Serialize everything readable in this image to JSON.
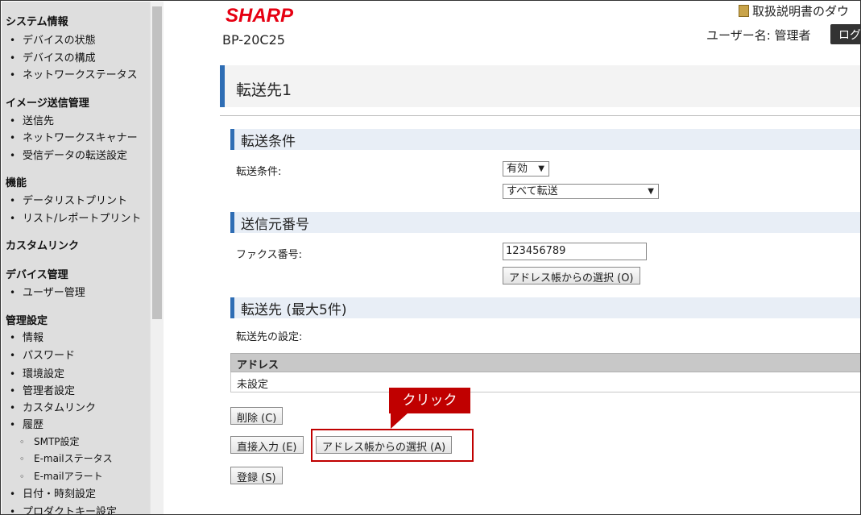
{
  "sidebar": {
    "sections": [
      {
        "title": "システム情報",
        "items": [
          "デバイスの状態",
          "デバイスの構成",
          "ネットワークステータス"
        ]
      },
      {
        "title": "イメージ送信管理",
        "items": [
          "送信先",
          "ネットワークスキャナー",
          "受信データの転送設定"
        ]
      },
      {
        "title": "機能",
        "items": [
          "データリストプリント",
          "リスト/レポートプリント"
        ]
      },
      {
        "title": "カスタムリンク",
        "items": []
      },
      {
        "title": "デバイス管理",
        "items": [
          "ユーザー管理"
        ]
      },
      {
        "title": "管理設定",
        "items": [
          "情報",
          "パスワード",
          "環境設定",
          "管理者設定",
          "カスタムリンク",
          "履歴"
        ]
      }
    ],
    "history_subitems": [
      "SMTP設定",
      "E-mailステータス",
      "E-mailアラート"
    ],
    "trailing_items": [
      "日付・時刻設定",
      "プロダクトキー設定"
    ]
  },
  "header": {
    "logo": "SHARP",
    "model": "BP-20C25",
    "manual_link": "取扱説明書のダウ",
    "username": "ユーザー名: 管理者",
    "logout_label": "ログ"
  },
  "page": {
    "title": "転送先1",
    "transfer_condition": {
      "heading": "転送条件",
      "label": "転送条件:",
      "enabled_select": "有効",
      "mode_select": "すべて転送"
    },
    "sender_number": {
      "heading": "送信元番号",
      "fax_label": "ファクス番号:",
      "fax_value": "123456789",
      "address_book_button": "アドレス帳からの選択 (O)"
    },
    "destinations": {
      "heading": "転送先 (最大5件)",
      "label": "転送先の設定:",
      "table_header": "アドレス",
      "table_value": "未設定",
      "delete_button": "削除 (C)",
      "direct_input_button": "直接入力 (E)",
      "address_book_button": "アドレス帳からの選択 (A)",
      "register_button": "登録 (S)"
    }
  },
  "annotation": {
    "callout_text": "クリック",
    "color": "#c00000"
  },
  "colors": {
    "brand": "#e60012",
    "accent": "#2e6db4",
    "sidebar_bg": "#dedede"
  }
}
